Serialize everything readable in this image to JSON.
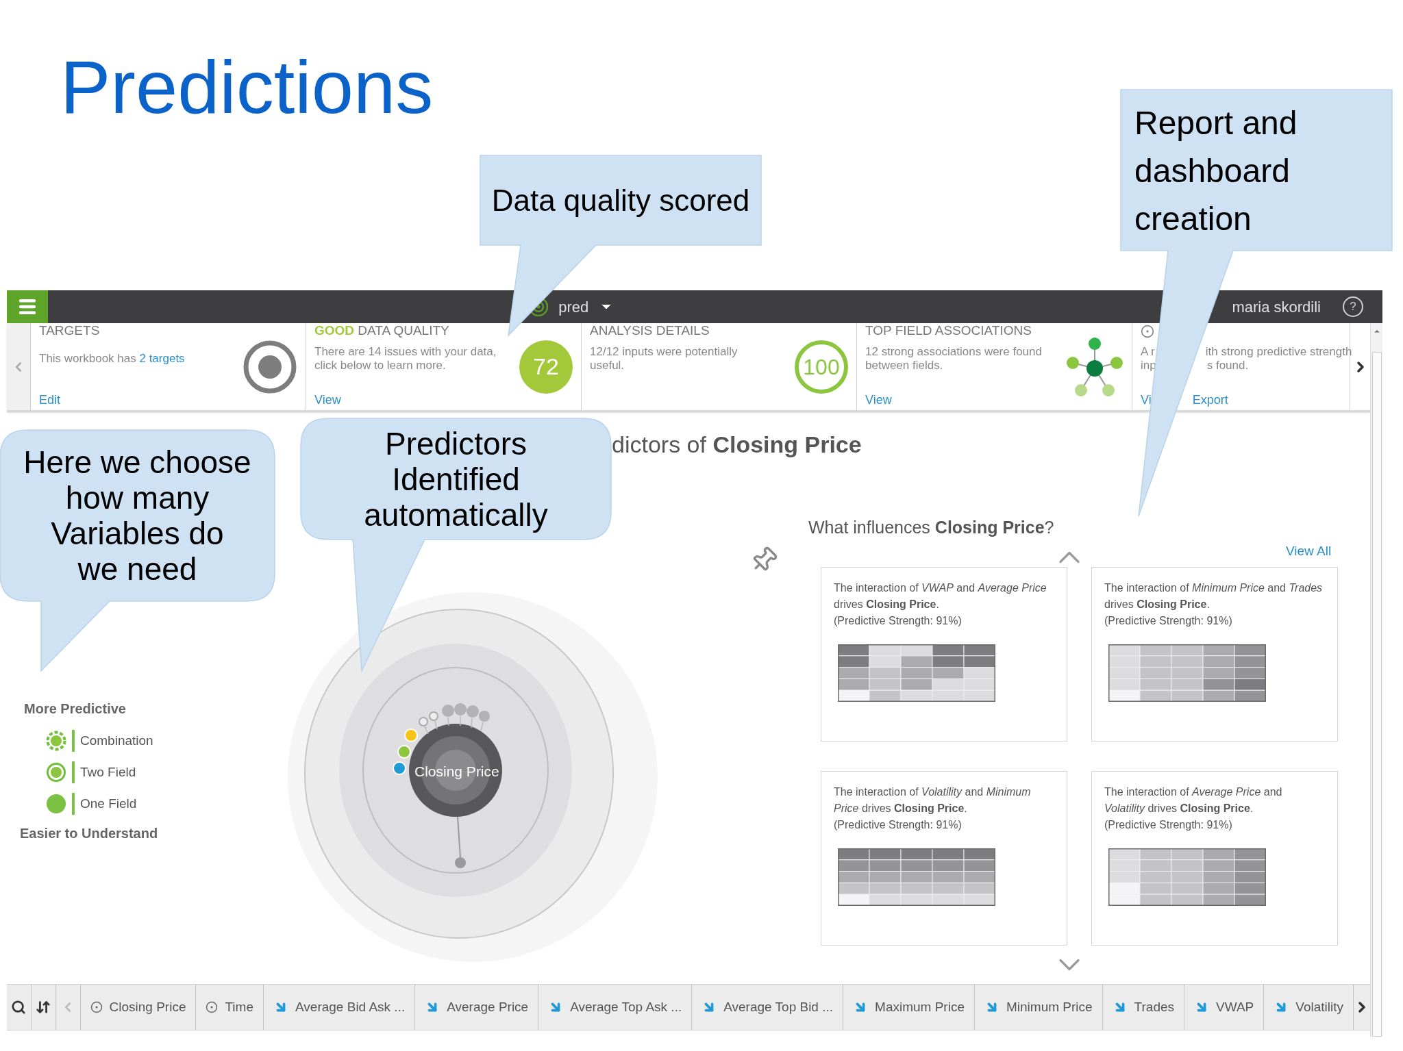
{
  "title": "Predictions",
  "callouts": [
    {
      "lines": [
        "Data quality scored"
      ]
    },
    {
      "lines": [
        "Report and",
        "dashboard",
        "creation"
      ]
    },
    {
      "lines": [
        "Here we choose",
        "how many",
        "Variables do",
        "we need"
      ]
    },
    {
      "lines": [
        "Predictors",
        "Identified",
        "automatically"
      ]
    }
  ],
  "topbar": {
    "project": "pred",
    "user": "maria skordili",
    "help": "?"
  },
  "summary_cards": [
    {
      "kind": "targets",
      "title": "TARGETS",
      "text": "This workbook has ",
      "link": "2 targets",
      "actions": [
        "Edit"
      ]
    },
    {
      "kind": "score",
      "rating": "GOOD",
      "title": "DATA QUALITY",
      "text": "There are 14 issues with your data, click below to learn more.",
      "score": "72",
      "actions": [
        "View"
      ]
    },
    {
      "kind": "score_ring",
      "title": "ANALYSIS DETAILS",
      "text": "12/12 inputs were potentially useful.",
      "score": "100"
    },
    {
      "kind": "network",
      "title": "TOP FIELD ASSOCIATIONS",
      "text": "12 strong associations were found between fields.",
      "actions": [
        "View"
      ]
    },
    {
      "kind": "partial",
      "lines": [
        [
          "A r",
          "ith strong predictive strength"
        ],
        [
          "inp",
          "s found."
        ]
      ],
      "actions": [
        "Vi",
        "Export"
      ]
    }
  ],
  "heading": "dictors of **Closing Price**",
  "legend": {
    "top": "More Predictive",
    "items": [
      {
        "kind": "combination",
        "label": "Combination"
      },
      {
        "kind": "two_field",
        "label": "Two Field"
      },
      {
        "kind": "one_field",
        "label": "One Field"
      }
    ],
    "bottom": "Easier to Understand"
  },
  "diagram": {
    "center": "Closing Price"
  },
  "influences": {
    "heading": "What influences **Closing Price**?",
    "view_all": "View All",
    "cards": [
      {
        "sentence": "The interaction of *VWAP* and *Average Price* drives **Closing Price**.",
        "strength": "(Predictive Strength: 91%)"
      },
      {
        "sentence": "The interaction of *Minimum Price* and *Trades* drives **Closing Price**.",
        "strength": "(Predictive Strength: 91%)"
      },
      {
        "sentence": "The interaction of *Volatility* and *Minimum Price* drives **Closing Price**.",
        "strength": "(Predictive Strength: 91%)"
      },
      {
        "sentence": "The interaction of *Average Price* and *Volatility* drives **Closing Price**.",
        "strength": "(Predictive Strength: 91%)"
      }
    ]
  },
  "fields_bar": {
    "items": [
      {
        "kind": "target",
        "label": "Closing Price"
      },
      {
        "kind": "target",
        "label": "Time"
      },
      {
        "kind": "input",
        "label": "Average Bid Ask ..."
      },
      {
        "kind": "input",
        "label": "Average Price"
      },
      {
        "kind": "input",
        "label": "Average Top Ask ..."
      },
      {
        "kind": "input",
        "label": "Average Top Bid ..."
      },
      {
        "kind": "input",
        "label": "Maximum Price"
      },
      {
        "kind": "input",
        "label": "Minimum Price"
      },
      {
        "kind": "input",
        "label": "Trades"
      },
      {
        "kind": "input",
        "label": "VWAP"
      },
      {
        "kind": "input",
        "label": "Volatility"
      }
    ]
  }
}
